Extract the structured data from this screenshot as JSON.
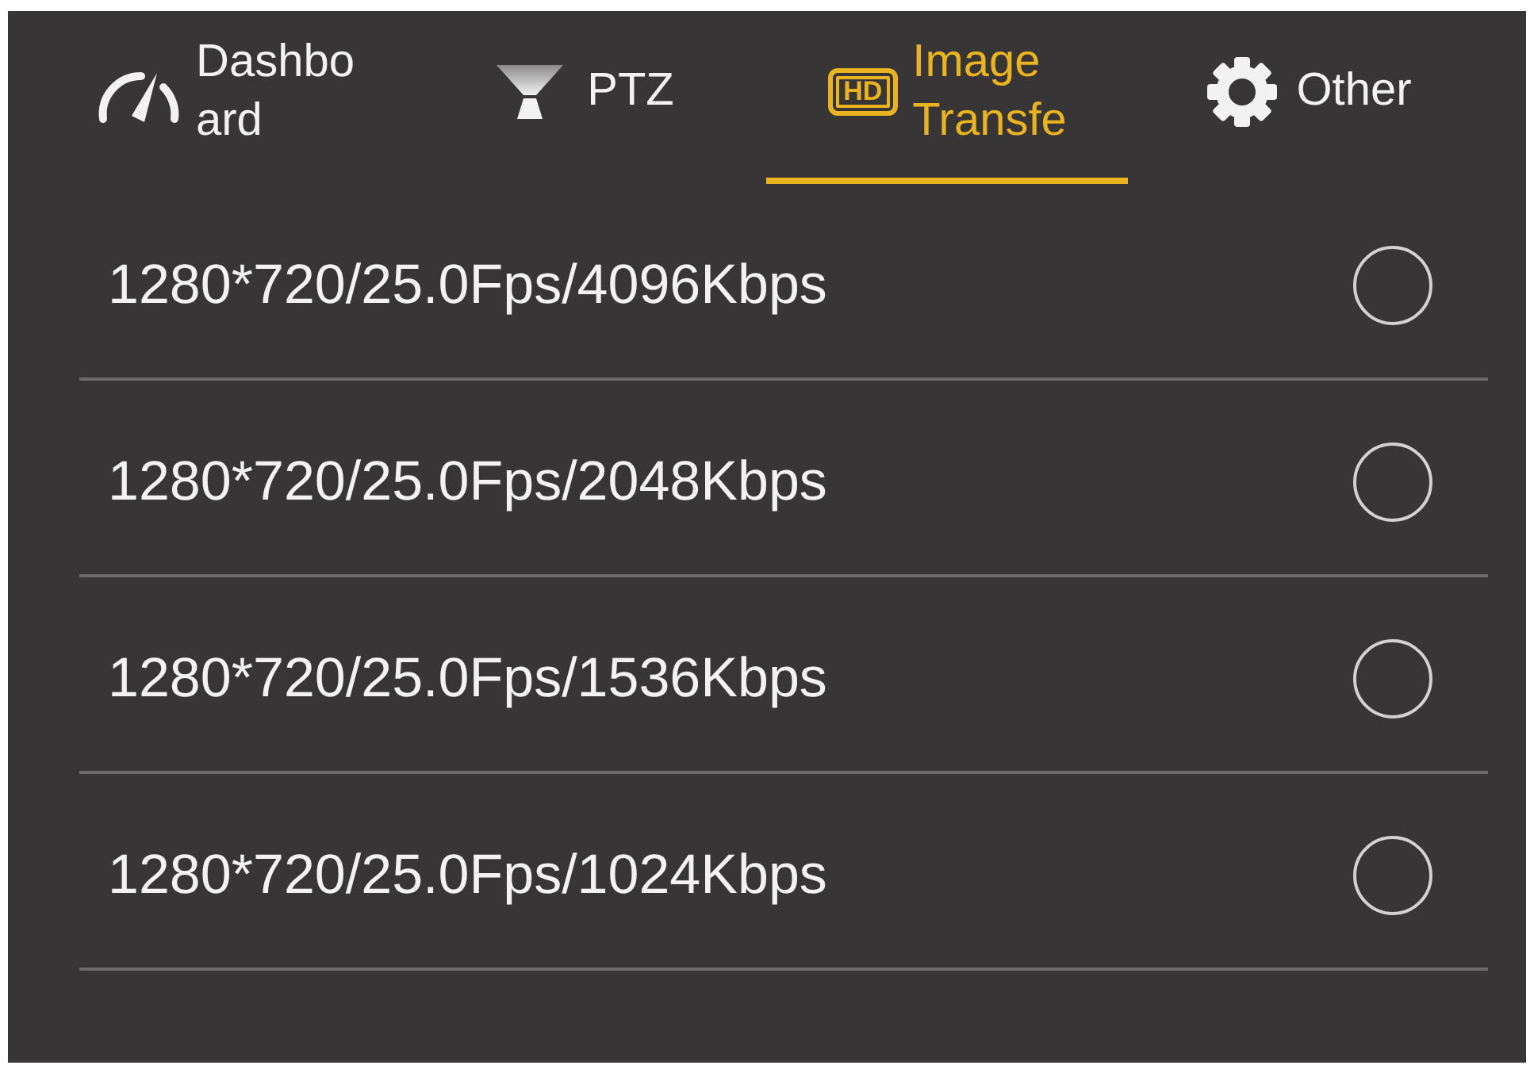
{
  "tabs": [
    {
      "label": "Dashbo\nard",
      "kind": "gauge",
      "selected": false
    },
    {
      "label": "PTZ",
      "kind": "ptz",
      "selected": false
    },
    {
      "label": "Image\nTransfe",
      "kind": "hd",
      "badge": "HD",
      "selected": true
    },
    {
      "label": "Other",
      "kind": "gear",
      "selected": false
    }
  ],
  "options": [
    {
      "label": "1280*720/25.0Fps/4096Kbps",
      "selected": false
    },
    {
      "label": "1280*720/25.0Fps/2048Kbps",
      "selected": false
    },
    {
      "label": "1280*720/25.0Fps/1536Kbps",
      "selected": false
    },
    {
      "label": "1280*720/25.0Fps/1024Kbps",
      "selected": false
    }
  ]
}
